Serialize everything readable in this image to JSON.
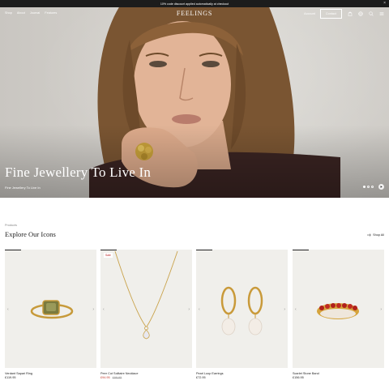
{
  "announcement": {
    "text": "10% code discount applied automatically at checkout",
    "close": "×"
  },
  "nav": {
    "links": [
      "Shop",
      "About",
      "Journal",
      "Features"
    ],
    "brand": "FEELINGS",
    "account": "Account",
    "contact": "Contact",
    "icons": [
      "bag-icon",
      "globe-icon",
      "search-icon",
      "menu-icon"
    ]
  },
  "hero": {
    "title": "Fine Jewellery To Live In",
    "cta": "Fine Jewellery To Live In",
    "slides": 3,
    "active_slide": 1
  },
  "products": {
    "eyebrow": "Products",
    "title": "Explore Our Icons",
    "shop_all": "Shop All",
    "items": [
      {
        "name": "Verdant Sapari Ring",
        "price": "£119.95",
        "sale": "",
        "was": ""
      },
      {
        "name": "Peer Cut Solitaire Necklace",
        "price": "£94.95",
        "sale": "Sale",
        "was": "£99.95"
      },
      {
        "name": "Pearl Loop Earrings",
        "price": "£72.95",
        "sale": "",
        "was": ""
      },
      {
        "name": "Scarlet Stone Band",
        "price": "£156.95",
        "sale": "",
        "was": ""
      }
    ]
  },
  "colors": {
    "sale": "#c0392b",
    "card_bg": "#f0efeb",
    "bar": "#1c1c1c"
  }
}
